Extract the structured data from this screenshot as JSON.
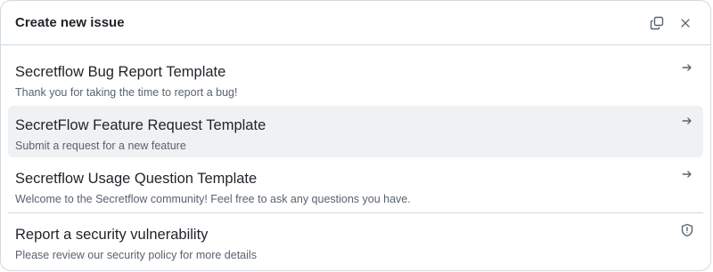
{
  "dialog": {
    "title": "Create new issue",
    "buttons": {
      "copy_icon": "copy-icon",
      "close_icon": "close-icon"
    }
  },
  "templates": [
    {
      "title": "Secretflow Bug Report Template",
      "description": "Thank you for taking the time to report a bug!",
      "icon": "arrow-right-icon"
    },
    {
      "title": "SecretFlow Feature Request Template",
      "description": "Submit a request for a new feature",
      "icon": "arrow-right-icon",
      "highlighted": true
    },
    {
      "title": "Secretflow Usage Question Template",
      "description": "Welcome to the Secretflow community! Feel free to ask any questions you have.",
      "icon": "arrow-right-icon"
    }
  ],
  "security": {
    "title": "Report a security vulnerability",
    "description": "Please review our security policy for more details",
    "icon": "shield-icon"
  },
  "colors": {
    "border": "#d1d9e0",
    "hover_bg": "#f0f1f3",
    "text": "#1f2328",
    "muted": "#59636e"
  }
}
